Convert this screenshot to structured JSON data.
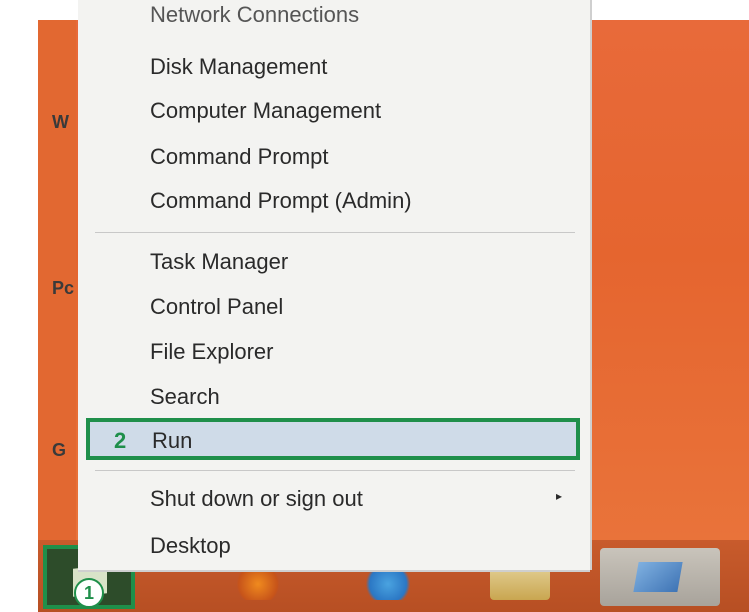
{
  "menu": {
    "items": [
      {
        "label": "Network Connections"
      },
      {
        "label": "Disk Management"
      },
      {
        "label": "Computer Management"
      },
      {
        "label": "Command Prompt"
      },
      {
        "label": "Command Prompt (Admin)"
      },
      {
        "label": "Task Manager"
      },
      {
        "label": "Control Panel"
      },
      {
        "label": "File Explorer"
      },
      {
        "label": "Search"
      },
      {
        "label": "Run"
      },
      {
        "label": "Shut down or sign out",
        "submenu_arrow": "▸"
      },
      {
        "label": "Desktop"
      }
    ]
  },
  "annotations": {
    "step1": "1",
    "step2": "2"
  },
  "desktop_edge_letters": [
    "W",
    "Pc",
    "G"
  ],
  "colors": {
    "desktop": "#e86a3a",
    "menu_bg": "#f3f3f1",
    "highlight": "#cfdbe8",
    "annotation_green": "#1f8f4a"
  }
}
